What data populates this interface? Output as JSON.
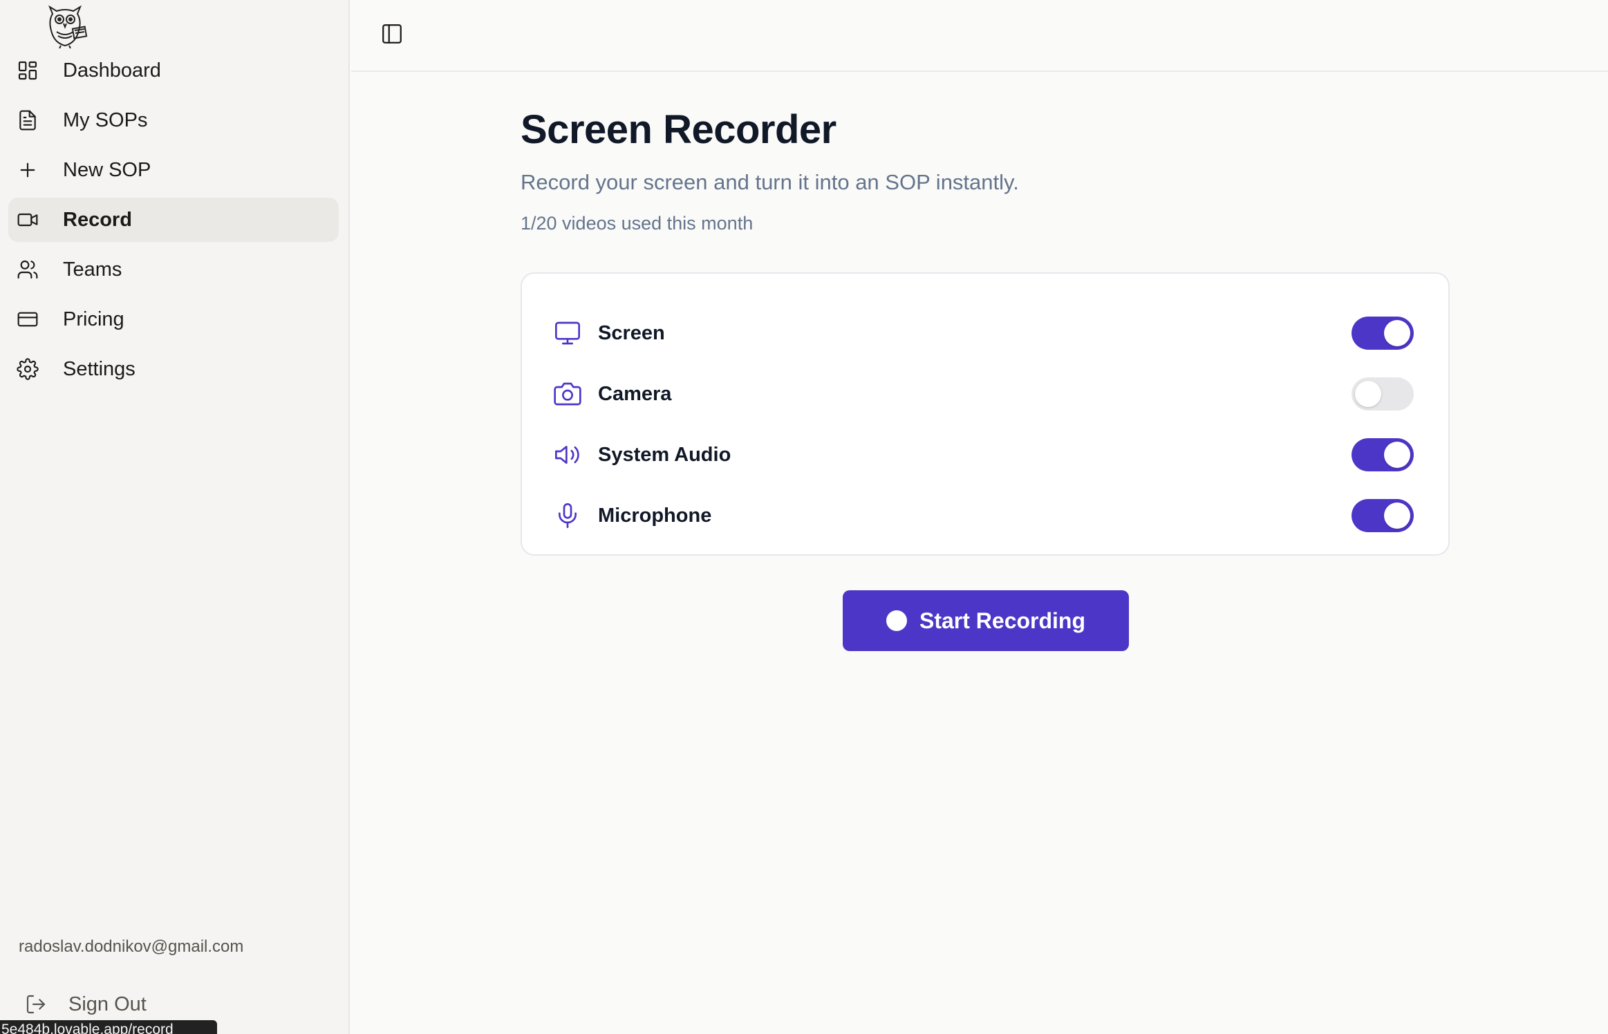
{
  "colors": {
    "accent": "#4c36c7",
    "sidebar_bg": "#f5f4f2",
    "active_item_bg": "#ebe9e6",
    "toggle_off": "#e7e7ea"
  },
  "sidebar": {
    "logo_icon": "owl-logo",
    "items": [
      {
        "label": "Dashboard",
        "icon": "dashboard-icon",
        "active": false
      },
      {
        "label": "My SOPs",
        "icon": "document-icon",
        "active": false
      },
      {
        "label": "New SOP",
        "icon": "plus-icon",
        "active": false
      },
      {
        "label": "Record",
        "icon": "video-icon",
        "active": true
      },
      {
        "label": "Teams",
        "icon": "users-icon",
        "active": false
      },
      {
        "label": "Pricing",
        "icon": "credit-card-icon",
        "active": false
      },
      {
        "label": "Settings",
        "icon": "gear-icon",
        "active": false
      }
    ],
    "user_email": "radoslav.dodnikov@gmail.com",
    "sign_out_label": "Sign Out"
  },
  "status_bar": {
    "url": "5e484b.lovable.app/record"
  },
  "header": {
    "toggle_icon": "sidebar-toggle-icon"
  },
  "main": {
    "title": "Screen Recorder",
    "subtitle": "Record your screen and turn it into an SOP instantly.",
    "usage": "1/20 videos used this month",
    "options": [
      {
        "label": "Screen",
        "icon": "monitor-icon",
        "enabled": true
      },
      {
        "label": "Camera",
        "icon": "camera-icon",
        "enabled": false
      },
      {
        "label": "System Audio",
        "icon": "speaker-icon",
        "enabled": true
      },
      {
        "label": "Microphone",
        "icon": "microphone-icon",
        "enabled": true
      }
    ],
    "start_button_label": "Start Recording"
  }
}
